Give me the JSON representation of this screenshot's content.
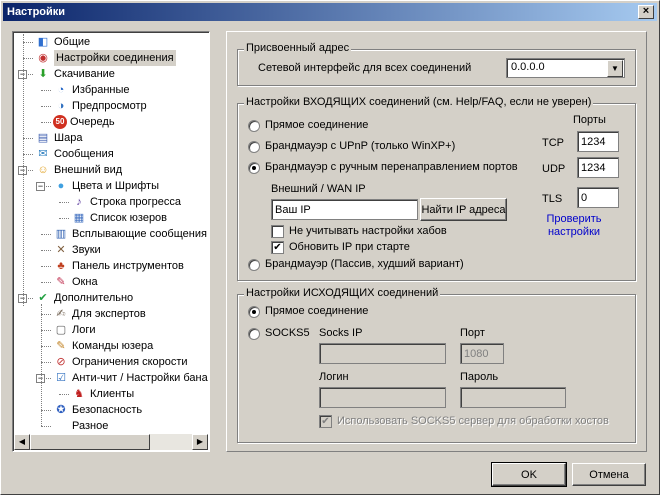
{
  "window": {
    "title": "Настройки",
    "close_glyph": "×"
  },
  "tree": {
    "items": [
      {
        "label": "Общие",
        "icon": "general-icon",
        "glyph": "◧",
        "color": "#2f6fd0"
      },
      {
        "label": "Настройки соединения",
        "icon": "connection-icon",
        "glyph": "◉",
        "color": "#c03030"
      },
      {
        "label": "Скачивание",
        "icon": "download-icon",
        "glyph": "⬇",
        "color": "#2aa02a"
      },
      {
        "label": "Избранные",
        "icon": "favorites-icon",
        "glyph": "◔",
        "color": "#1f63c6"
      },
      {
        "label": "Предпросмотр",
        "icon": "preview-icon",
        "glyph": "◑",
        "color": "#3070c0"
      },
      {
        "label": "Очередь",
        "icon": "queue-icon",
        "glyph": "50",
        "color": "#d03020"
      },
      {
        "label": "Шара",
        "icon": "share-icon",
        "glyph": "▤",
        "color": "#4060b0"
      },
      {
        "label": "Сообщения",
        "icon": "messages-icon",
        "glyph": "✉",
        "color": "#3080c0"
      },
      {
        "label": "Внешний вид",
        "icon": "appearance-icon",
        "glyph": "☺",
        "color": "#e0a020"
      },
      {
        "label": "Цвета и Шрифты",
        "icon": "colors-fonts-icon",
        "glyph": "●",
        "color": "#40a0e0"
      },
      {
        "label": "Строка прогресса",
        "icon": "progress-bar-icon",
        "glyph": "♪",
        "color": "#6040a0"
      },
      {
        "label": "Список юзеров",
        "icon": "user-list-icon",
        "glyph": "▦",
        "color": "#4070c0"
      },
      {
        "label": "Всплывающие сообщения",
        "icon": "popup-messages-icon",
        "glyph": "▥",
        "color": "#3060b0"
      },
      {
        "label": "Звуки",
        "icon": "sounds-icon",
        "glyph": "✕",
        "color": "#806040"
      },
      {
        "label": "Панель инструментов",
        "icon": "toolbar-icon",
        "glyph": "♣",
        "color": "#c04020"
      },
      {
        "label": "Окна",
        "icon": "windows-icon",
        "glyph": "✎",
        "color": "#c03050"
      },
      {
        "label": "Дополнительно",
        "icon": "advanced-icon",
        "glyph": "✔",
        "color": "#20a040"
      },
      {
        "label": "Для экспертов",
        "icon": "experts-icon",
        "glyph": "✍",
        "color": "#706050"
      },
      {
        "label": "Логи",
        "icon": "logs-icon",
        "glyph": "▢",
        "color": "#606060"
      },
      {
        "label": "Команды юзера",
        "icon": "user-commands-icon",
        "glyph": "✎",
        "color": "#c08020"
      },
      {
        "label": "Ограничения скорости",
        "icon": "speed-limit-icon",
        "glyph": "⊘",
        "color": "#c03030"
      },
      {
        "label": "Анти-чит / Настройки бана",
        "icon": "anticheat-icon",
        "glyph": "☑",
        "color": "#3070c0"
      },
      {
        "label": "Клиенты",
        "icon": "clients-icon",
        "glyph": "♞",
        "color": "#c02020"
      },
      {
        "label": "Безопасность",
        "icon": "security-icon",
        "glyph": "✪",
        "color": "#3060c0"
      },
      {
        "label": "Разное",
        "icon": "misc-icon",
        "glyph": "",
        "color": "#000000"
      }
    ],
    "scroll_left_glyph": "◀",
    "scroll_right_glyph": "▶"
  },
  "assigned": {
    "title": "Присвоенный адрес",
    "label": "Сетевой интерфейс для всех соединений",
    "value": "0.0.0.0",
    "arrow": "▼"
  },
  "incoming": {
    "title": "Настройки ВХОДЯЩИХ соединений (см. Help/FAQ, если не уверен)",
    "port_header": "Порты",
    "direct": "Прямое соединение",
    "upnp": "Брандмауэр с UPnP (только WinXP+)",
    "manual": "Брандмауэр с ручным перенаправлением портов",
    "wan_label": "Внешний / WAN IP",
    "wan_value": "Ваш IP",
    "find_ip": "Найти IP адреса",
    "ignore_hubs": "Не учитывать настройки хабов",
    "update_ip": "Обновить IP при старте",
    "passive": "Брандмауэр (Пассив, худший вариант)",
    "tcp_label": "TCP",
    "tcp_value": "1234",
    "udp_label": "UDP",
    "udp_value": "1234",
    "tls_label": "TLS",
    "tls_value": "0",
    "check_link": "Проверить настройки",
    "check_glyph": "✔"
  },
  "outgoing": {
    "title": "Настройки ИСХОДЯЩИХ соединений",
    "direct": "Прямое соединение",
    "socks5": "SOCKS5",
    "socks_ip_label": "Socks IP",
    "port_label": "Порт",
    "port_value": "1080",
    "login_label": "Логин",
    "password_label": "Пароль",
    "use_socks_hosts": "Использовать SOCKS5 сервер для обработки хостов",
    "check_glyph": "✔"
  },
  "footer": {
    "ok": "OK",
    "cancel": "Отмена"
  }
}
